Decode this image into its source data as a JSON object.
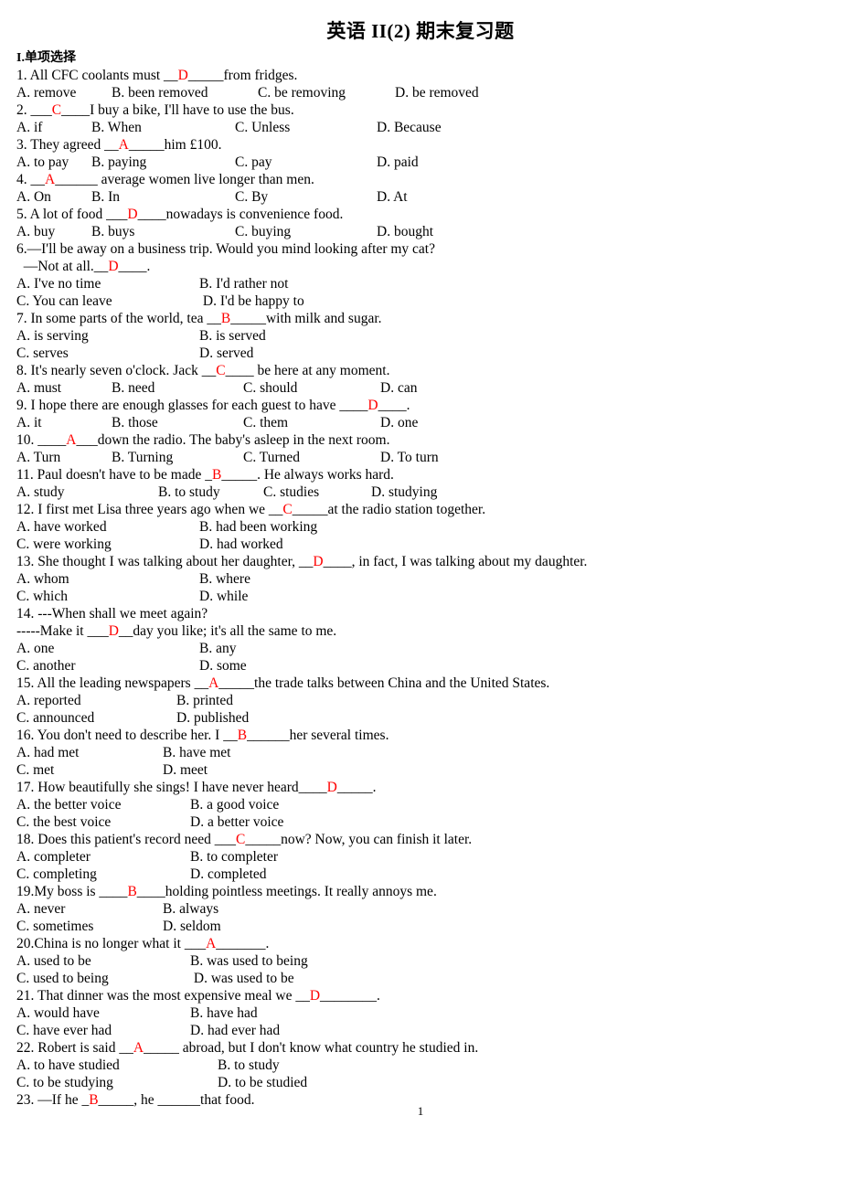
{
  "document": {
    "title": "英语 II(2)  期末复习题",
    "section_heading": "I.单项选择",
    "page_number": "1",
    "answer_color": "#ff0000"
  },
  "questions": [
    {
      "number": "1.",
      "stem_before": "1. All CFC coolants must __",
      "answer": "D",
      "stem_after": "_____from fridges.",
      "options": [
        "A. remove",
        "B. been removed",
        "C. be removing",
        "D. be removed"
      ],
      "option_layout": "four-col",
      "option_widths": [
        104,
        160,
        150,
        0
      ]
    },
    {
      "number": "2.",
      "stem_before": "2. ___",
      "answer": "C",
      "stem_after": "____I buy a bike, I'll have to use the bus.",
      "options": [
        "A. if",
        "B. When",
        "C. Unless",
        "D. Because"
      ],
      "option_layout": "four-col",
      "option_widths": [
        82,
        157,
        155,
        0
      ]
    },
    {
      "number": "3.",
      "stem_before": "3. They agreed __",
      "answer": "A",
      "stem_after": "_____him £100.",
      "options": [
        "A. to pay",
        "B. paying",
        "C. pay",
        "D. paid"
      ],
      "option_layout": "four-col",
      "option_widths": [
        82,
        157,
        155,
        0
      ]
    },
    {
      "number": "4.",
      "stem_before": "4. __",
      "answer": "A",
      "stem_after": "______ average women live longer than men.",
      "options": [
        "A. On",
        "B. In",
        "C. By",
        "D. At"
      ],
      "option_layout": "four-col",
      "option_widths": [
        82,
        157,
        155,
        0
      ]
    },
    {
      "number": "5.",
      "stem_before": "5. A lot of food ___",
      "answer": "D",
      "stem_after": "____nowadays is convenience food.",
      "options": [
        "A. buy",
        "B. buys",
        "C. buying",
        "D. bought"
      ],
      "option_layout": "four-col",
      "option_widths": [
        82,
        157,
        155,
        0
      ]
    },
    {
      "number": "6.",
      "stem_before": "6.—I'll be away on a business trip. Would you mind looking after my cat?",
      "stem_line2_before": "  —Not at all.__",
      "answer": "D",
      "stem_after": "____.",
      "options": [
        "A. I've no time",
        "B. I'd rather not",
        "C. You can leave",
        " D. I'd be happy to"
      ],
      "option_layout": "two-col",
      "option_widths": [
        200,
        0
      ]
    },
    {
      "number": "7.",
      "stem_before": "7. In some parts of the world, tea __",
      "answer": "B",
      "stem_after": "_____with milk and sugar.",
      "options": [
        "A. is serving",
        "B. is served",
        "C. serves",
        "D. served"
      ],
      "option_layout": "two-col",
      "option_widths": [
        200,
        0
      ]
    },
    {
      "number": "8.",
      "stem_before": "8. It's nearly seven o'clock. Jack __",
      "answer": "C",
      "stem_after": "____ be here at any moment.",
      "options": [
        "A. must",
        "B. need",
        "C. should",
        "D. can"
      ],
      "option_layout": "four-col",
      "option_widths": [
        104,
        144,
        150,
        0
      ]
    },
    {
      "number": "9.",
      "stem_before": "9. I hope there are enough glasses for each guest to have ____",
      "answer": "D",
      "stem_after": "____.",
      "options": [
        "A. it",
        "B. those",
        "C. them",
        "D. one"
      ],
      "option_layout": "four-col",
      "option_widths": [
        104,
        144,
        150,
        0
      ]
    },
    {
      "number": "10.",
      "stem_before": "10. ____",
      "answer": "A",
      "stem_after": "___down the radio. The baby's asleep in the next room.",
      "options": [
        "A. Turn",
        "B. Turning",
        "C. Turned",
        "D. To turn"
      ],
      "option_layout": "four-col",
      "option_widths": [
        104,
        144,
        150,
        0
      ]
    },
    {
      "number": "11.",
      "stem_before": "11. Paul doesn't have to be made _",
      "answer": "B",
      "stem_after": "_____. He always works hard.",
      "options": [
        "A. study",
        "B. to study",
        "C. studies",
        "D. studying"
      ],
      "option_layout": "four-col",
      "option_widths": [
        155,
        115,
        118,
        0
      ]
    },
    {
      "number": "12.",
      "stem_before": "12. I first met Lisa three years ago when we __",
      "answer": "C",
      "stem_after": "_____at the radio station together.",
      "options": [
        "A. have worked",
        "B. had been working",
        "C. were working",
        "D. had worked"
      ],
      "option_layout": "two-col",
      "option_widths": [
        200,
        0
      ]
    },
    {
      "number": "13.",
      "stem_before": "13. She thought I was talking about her daughter, __",
      "answer": "D",
      "stem_after": "____, in fact, I was talking about my daughter.",
      "options": [
        "A. whom",
        "B. where",
        "C. which",
        "D. while"
      ],
      "option_layout": "two-col",
      "option_widths": [
        200,
        0
      ]
    },
    {
      "number": "14.",
      "stem_before": "14. ---When shall we meet again?",
      "stem_line2_before": "-----Make it ___",
      "answer": "D",
      "stem_after": "__day you like; it's all the same to me.",
      "options": [
        "A. one",
        "B. any",
        "C. another",
        "D. some"
      ],
      "option_layout": "two-col",
      "option_widths": [
        200,
        0
      ]
    },
    {
      "number": "15.",
      "stem_before": "15. All the leading newspapers __",
      "answer": "A",
      "stem_after": "_____the trade talks between China and the United States.",
      "options": [
        "A. reported",
        "B. printed",
        "C. announced",
        "D. published"
      ],
      "option_layout": "two-col",
      "option_widths": [
        175,
        0
      ]
    },
    {
      "number": "16.",
      "stem_before": "16. You don't need to describe her. I __",
      "answer": "B",
      "stem_after": "______her several times.",
      "options": [
        "A. had met",
        "B. have met",
        "C. met",
        "D. meet"
      ],
      "option_layout": "two-col",
      "option_widths": [
        160,
        0
      ]
    },
    {
      "number": "17.",
      "stem_before": "17. How beautifully she sings! I have never heard____",
      "answer": "D",
      "stem_after": "_____.",
      "options": [
        "A. the better voice",
        "B. a good voice",
        "C. the best voice",
        "D. a better voice"
      ],
      "option_layout": "two-col",
      "option_widths": [
        190,
        0
      ]
    },
    {
      "number": "18.",
      "stem_before": "18. Does this patient's record need ___",
      "answer": "C",
      "stem_after": "_____now? Now, you can finish it later.",
      "options": [
        "A. completer",
        "B. to completer",
        "C. completing",
        "D. completed"
      ],
      "option_layout": "two-col",
      "option_widths": [
        190,
        0
      ]
    },
    {
      "number": "19.",
      "stem_before": "19.My boss is ____",
      "answer": "B",
      "stem_after": "____holding pointless meetings. It really annoys me.",
      "options": [
        "A. never",
        "B. always",
        "C. sometimes",
        "D. seldom"
      ],
      "option_layout": "two-col",
      "option_widths": [
        160,
        0
      ]
    },
    {
      "number": "20.",
      "stem_before": "20.China is no longer what it ___",
      "answer": "A",
      "stem_after": "_______.",
      "options": [
        "A. used to be",
        "B. was used to being",
        "C. used to being",
        " D. was used to be"
      ],
      "option_layout": "two-col",
      "option_widths": [
        190,
        0
      ]
    },
    {
      "number": "21.",
      "stem_before": "21. That dinner was the most expensive meal we __",
      "answer": "D",
      "stem_after": "________.",
      "options": [
        "A. would have",
        "B. have had",
        "C. have ever had",
        "D. had ever had"
      ],
      "option_layout": "two-col",
      "option_widths": [
        190,
        0
      ]
    },
    {
      "number": "22.",
      "stem_before": "22. Robert is said __",
      "answer": "A",
      "stem_after": "_____ abroad, but I don't know what country he studied in.",
      "options": [
        "A. to have studied",
        "B. to study",
        "C. to be studying",
        "D. to be studied"
      ],
      "option_layout": "two-col",
      "option_widths": [
        220,
        0
      ]
    },
    {
      "number": "23.",
      "stem_before": "23. —If he _",
      "answer": "B",
      "stem_after": "_____, he ______that food.",
      "options": [],
      "option_layout": "none",
      "option_widths": []
    }
  ]
}
